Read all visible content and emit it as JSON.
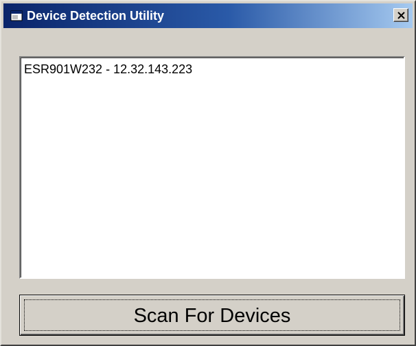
{
  "window": {
    "title": "Device Detection Utility",
    "icon": "app-window-icon",
    "close_icon": "close-icon"
  },
  "device_list": {
    "items": [
      "ESR901W232 - 12.32.143.223"
    ]
  },
  "actions": {
    "scan_label": "Scan For Devices"
  },
  "colors": {
    "titlebar_start": "#0a246a",
    "titlebar_end": "#a6caf0",
    "window_face": "#d4d0c8",
    "list_background": "#ffffff"
  }
}
